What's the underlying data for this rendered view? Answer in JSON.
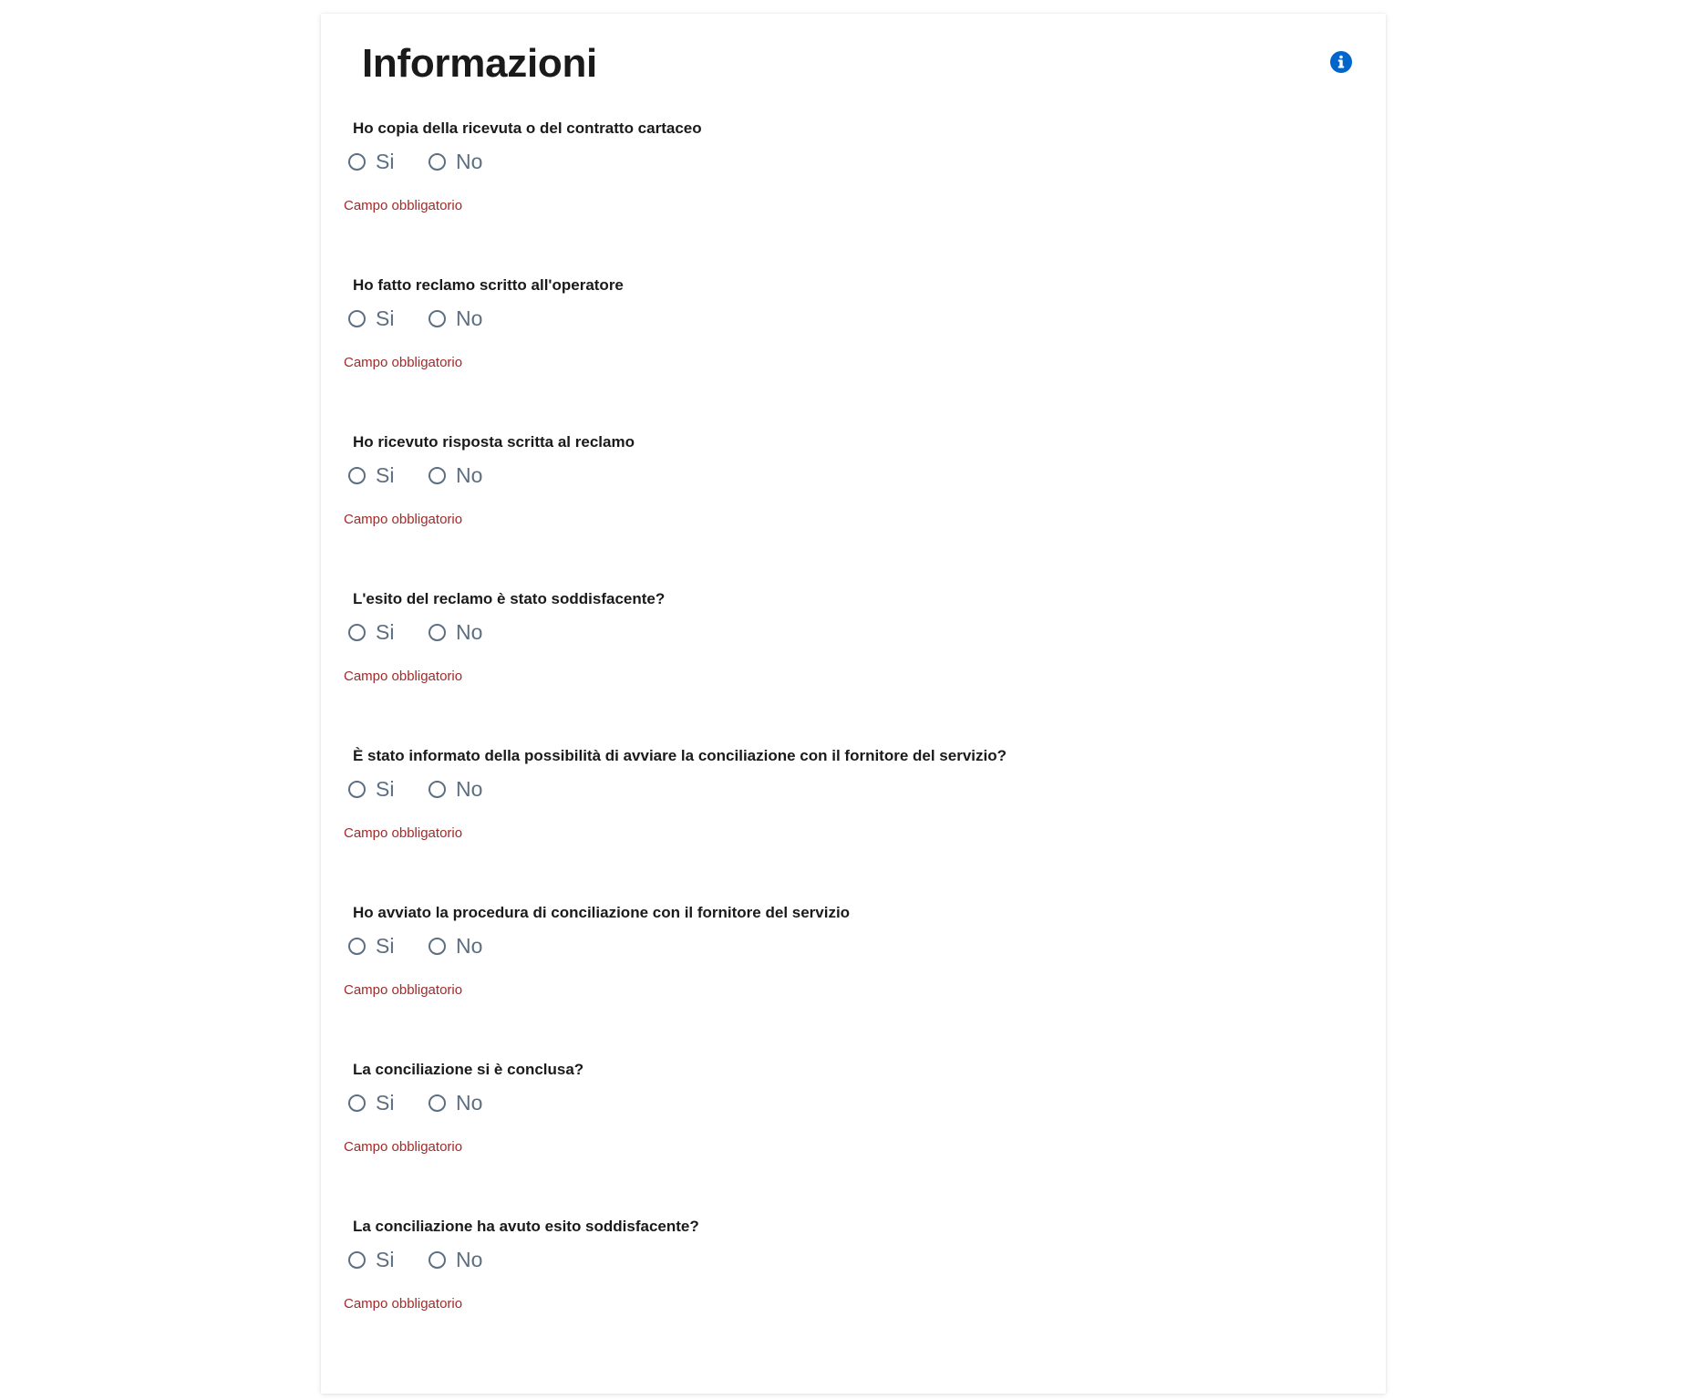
{
  "card": {
    "title": "Informazioni",
    "info_icon": "info-circle-icon"
  },
  "colors": {
    "accent": "#0066cc",
    "error": "#a32a2a",
    "radio": "#5c6f82",
    "text": "#1a1a1a"
  },
  "questions": [
    {
      "label": "Ho copia della ricevuta o del contratto cartaceo",
      "options": [
        "Si",
        "No"
      ],
      "selected": null,
      "error": "Campo obbligatorio"
    },
    {
      "label": "Ho fatto reclamo scritto all'operatore",
      "options": [
        "Si",
        "No"
      ],
      "selected": null,
      "error": "Campo obbligatorio"
    },
    {
      "label": "Ho ricevuto risposta scritta al reclamo",
      "options": [
        "Si",
        "No"
      ],
      "selected": null,
      "error": "Campo obbligatorio"
    },
    {
      "label": "L'esito del reclamo è stato soddisfacente?",
      "options": [
        "Si",
        "No"
      ],
      "selected": null,
      "error": "Campo obbligatorio"
    },
    {
      "label": "È stato informato della possibilità di avviare la conciliazione con il fornitore del servizio?",
      "options": [
        "Si",
        "No"
      ],
      "selected": null,
      "error": "Campo obbligatorio"
    },
    {
      "label": "Ho avviato la procedura di conciliazione con il fornitore del servizio",
      "options": [
        "Si",
        "No"
      ],
      "selected": null,
      "error": "Campo obbligatorio"
    },
    {
      "label": "La conciliazione si è conclusa?",
      "options": [
        "Si",
        "No"
      ],
      "selected": null,
      "error": "Campo obbligatorio"
    },
    {
      "label": "La conciliazione ha avuto esito soddisfacente?",
      "options": [
        "Si",
        "No"
      ],
      "selected": null,
      "error": "Campo obbligatorio"
    }
  ]
}
